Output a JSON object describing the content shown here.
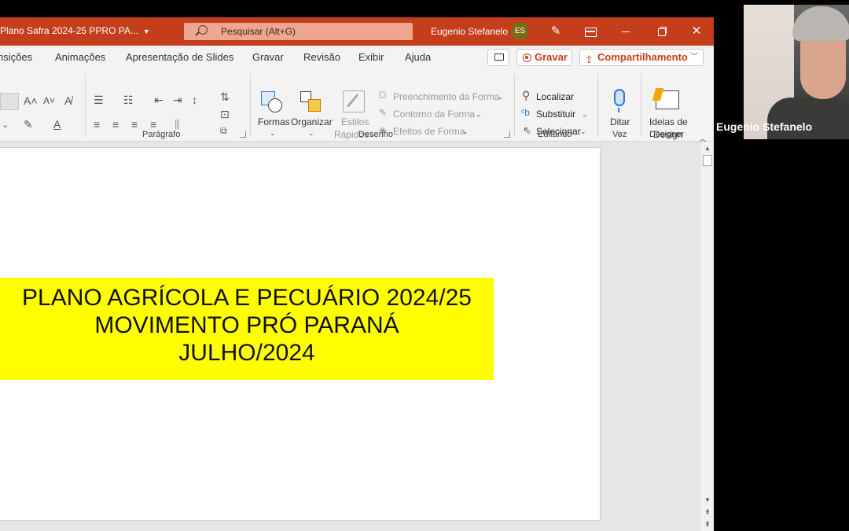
{
  "titlebar": {
    "document_title": "Plano Safra 2024-25 PPRO PA...",
    "search_placeholder": "Pesquisar (Alt+G)",
    "user_name": "Eugenio Stefanelo",
    "user_initials": "ES"
  },
  "tabs": [
    "Transições",
    "Animações",
    "Apresentação de Slides",
    "Gravar",
    "Revisão",
    "Exibir",
    "Ajuda"
  ],
  "actions": {
    "record_label": "Gravar",
    "share_label": "Compartilhamento"
  },
  "ribbon": {
    "groups": {
      "paragraph": "Parágrafo",
      "drawing": "Desenho",
      "editing": "Editando",
      "voice": "Voz",
      "designer": "Designer"
    },
    "drawing": {
      "shapes": "Formas",
      "arrange": "Organizar",
      "quick_styles_1": "Estilos",
      "quick_styles_2": "Rápidos",
      "shape_fill": "Preenchimento da Forma",
      "shape_outline": "Contorno da Forma",
      "shape_effects": "Efeitos de Forma"
    },
    "editing": {
      "find": "Localizar",
      "replace": "Substituir",
      "select": "Selecionar"
    },
    "voice": {
      "dictate": "Ditar"
    },
    "designer": {
      "ideas_1": "Ideias de",
      "ideas_2": "Design"
    }
  },
  "slide": {
    "title_lines": [
      "PLANO AGRÍCOLA E PECUÁRIO 2024/25",
      "MOVIMENTO PRÓ PARANÁ",
      "JULHO/2024"
    ],
    "highlight_color": "#ffff00"
  },
  "webcam": {
    "participant_name": "Eugenio Stefanelo"
  },
  "colors": {
    "accent": "#c43e1c"
  }
}
